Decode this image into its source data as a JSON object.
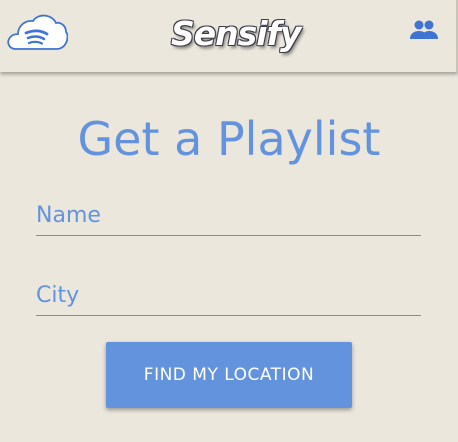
{
  "header": {
    "logo_icon": "cloud-logo-icon",
    "brand_title": "Sensify",
    "people_icon": "people-icon"
  },
  "form": {
    "title": "Get a Playlist",
    "name_placeholder": "Name",
    "name_value": "",
    "city_placeholder": "City",
    "city_value": "",
    "find_location_label": "FIND MY LOCATION"
  },
  "colors": {
    "background": "#ebe7dd",
    "accent": "#6493de",
    "button_text": "#ffffff"
  }
}
